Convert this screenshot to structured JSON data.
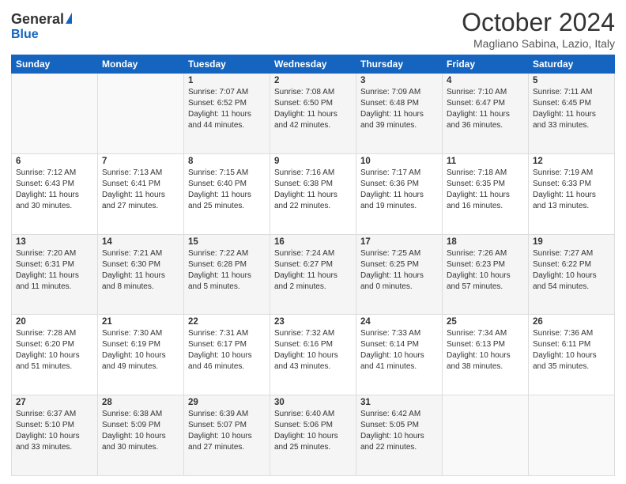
{
  "logo": {
    "general": "General",
    "blue": "Blue"
  },
  "title": "October 2024",
  "location": "Magliano Sabina, Lazio, Italy",
  "weekdays": [
    "Sunday",
    "Monday",
    "Tuesday",
    "Wednesday",
    "Thursday",
    "Friday",
    "Saturday"
  ],
  "weeks": [
    [
      {
        "day": "",
        "info": ""
      },
      {
        "day": "",
        "info": ""
      },
      {
        "day": "1",
        "info": "Sunrise: 7:07 AM\nSunset: 6:52 PM\nDaylight: 11 hours and 44 minutes."
      },
      {
        "day": "2",
        "info": "Sunrise: 7:08 AM\nSunset: 6:50 PM\nDaylight: 11 hours and 42 minutes."
      },
      {
        "day": "3",
        "info": "Sunrise: 7:09 AM\nSunset: 6:48 PM\nDaylight: 11 hours and 39 minutes."
      },
      {
        "day": "4",
        "info": "Sunrise: 7:10 AM\nSunset: 6:47 PM\nDaylight: 11 hours and 36 minutes."
      },
      {
        "day": "5",
        "info": "Sunrise: 7:11 AM\nSunset: 6:45 PM\nDaylight: 11 hours and 33 minutes."
      }
    ],
    [
      {
        "day": "6",
        "info": "Sunrise: 7:12 AM\nSunset: 6:43 PM\nDaylight: 11 hours and 30 minutes."
      },
      {
        "day": "7",
        "info": "Sunrise: 7:13 AM\nSunset: 6:41 PM\nDaylight: 11 hours and 27 minutes."
      },
      {
        "day": "8",
        "info": "Sunrise: 7:15 AM\nSunset: 6:40 PM\nDaylight: 11 hours and 25 minutes."
      },
      {
        "day": "9",
        "info": "Sunrise: 7:16 AM\nSunset: 6:38 PM\nDaylight: 11 hours and 22 minutes."
      },
      {
        "day": "10",
        "info": "Sunrise: 7:17 AM\nSunset: 6:36 PM\nDaylight: 11 hours and 19 minutes."
      },
      {
        "day": "11",
        "info": "Sunrise: 7:18 AM\nSunset: 6:35 PM\nDaylight: 11 hours and 16 minutes."
      },
      {
        "day": "12",
        "info": "Sunrise: 7:19 AM\nSunset: 6:33 PM\nDaylight: 11 hours and 13 minutes."
      }
    ],
    [
      {
        "day": "13",
        "info": "Sunrise: 7:20 AM\nSunset: 6:31 PM\nDaylight: 11 hours and 11 minutes."
      },
      {
        "day": "14",
        "info": "Sunrise: 7:21 AM\nSunset: 6:30 PM\nDaylight: 11 hours and 8 minutes."
      },
      {
        "day": "15",
        "info": "Sunrise: 7:22 AM\nSunset: 6:28 PM\nDaylight: 11 hours and 5 minutes."
      },
      {
        "day": "16",
        "info": "Sunrise: 7:24 AM\nSunset: 6:27 PM\nDaylight: 11 hours and 2 minutes."
      },
      {
        "day": "17",
        "info": "Sunrise: 7:25 AM\nSunset: 6:25 PM\nDaylight: 11 hours and 0 minutes."
      },
      {
        "day": "18",
        "info": "Sunrise: 7:26 AM\nSunset: 6:23 PM\nDaylight: 10 hours and 57 minutes."
      },
      {
        "day": "19",
        "info": "Sunrise: 7:27 AM\nSunset: 6:22 PM\nDaylight: 10 hours and 54 minutes."
      }
    ],
    [
      {
        "day": "20",
        "info": "Sunrise: 7:28 AM\nSunset: 6:20 PM\nDaylight: 10 hours and 51 minutes."
      },
      {
        "day": "21",
        "info": "Sunrise: 7:30 AM\nSunset: 6:19 PM\nDaylight: 10 hours and 49 minutes."
      },
      {
        "day": "22",
        "info": "Sunrise: 7:31 AM\nSunset: 6:17 PM\nDaylight: 10 hours and 46 minutes."
      },
      {
        "day": "23",
        "info": "Sunrise: 7:32 AM\nSunset: 6:16 PM\nDaylight: 10 hours and 43 minutes."
      },
      {
        "day": "24",
        "info": "Sunrise: 7:33 AM\nSunset: 6:14 PM\nDaylight: 10 hours and 41 minutes."
      },
      {
        "day": "25",
        "info": "Sunrise: 7:34 AM\nSunset: 6:13 PM\nDaylight: 10 hours and 38 minutes."
      },
      {
        "day": "26",
        "info": "Sunrise: 7:36 AM\nSunset: 6:11 PM\nDaylight: 10 hours and 35 minutes."
      }
    ],
    [
      {
        "day": "27",
        "info": "Sunrise: 6:37 AM\nSunset: 5:10 PM\nDaylight: 10 hours and 33 minutes."
      },
      {
        "day": "28",
        "info": "Sunrise: 6:38 AM\nSunset: 5:09 PM\nDaylight: 10 hours and 30 minutes."
      },
      {
        "day": "29",
        "info": "Sunrise: 6:39 AM\nSunset: 5:07 PM\nDaylight: 10 hours and 27 minutes."
      },
      {
        "day": "30",
        "info": "Sunrise: 6:40 AM\nSunset: 5:06 PM\nDaylight: 10 hours and 25 minutes."
      },
      {
        "day": "31",
        "info": "Sunrise: 6:42 AM\nSunset: 5:05 PM\nDaylight: 10 hours and 22 minutes."
      },
      {
        "day": "",
        "info": ""
      },
      {
        "day": "",
        "info": ""
      }
    ]
  ]
}
